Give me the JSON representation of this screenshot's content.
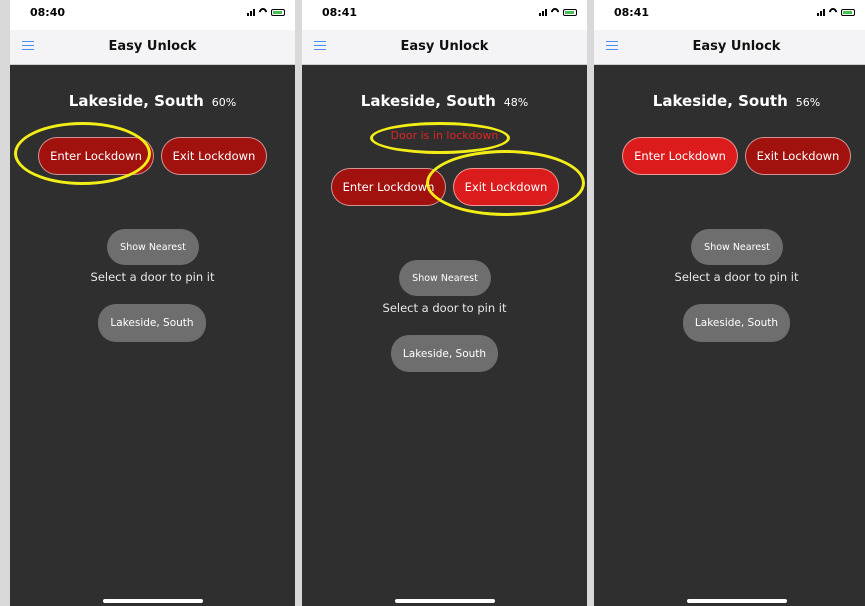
{
  "app_title": "Easy Unlock",
  "colors": {
    "highlight": "#f3ee17",
    "enter_dark": "#a1110e",
    "button_bright": "#dc1c1c",
    "lockdown_text": "#e02525",
    "screen_bg": "#2f2f2f"
  },
  "icons": [
    "hamburger-menu-icon",
    "signal-icon",
    "wifi-icon",
    "battery-icon"
  ],
  "phones": [
    {
      "time": "08:40",
      "door": "Lakeside, South",
      "battery_pct": "60%",
      "lockdown_message": "",
      "enter_label": "Enter Lockdown",
      "exit_label": "Exit Lockdown",
      "show_nearest": "Show Nearest",
      "hint": "Select a door to pin it",
      "pinned_door": "Lakeside, South"
    },
    {
      "time": "08:41",
      "door": "Lakeside, South",
      "battery_pct": "48%",
      "lockdown_message": "Door is in lockdown",
      "enter_label": "Enter Lockdown",
      "exit_label": "Exit Lockdown",
      "show_nearest": "Show Nearest",
      "hint": "Select a door to pin it",
      "pinned_door": "Lakeside, South"
    },
    {
      "time": "08:41",
      "door": "Lakeside, South",
      "battery_pct": "56%",
      "lockdown_message": "",
      "enter_label": "Enter Lockdown",
      "exit_label": "Exit Lockdown",
      "show_nearest": "Show Nearest",
      "hint": "Select a door to pin it",
      "pinned_door": "Lakeside, South"
    }
  ]
}
